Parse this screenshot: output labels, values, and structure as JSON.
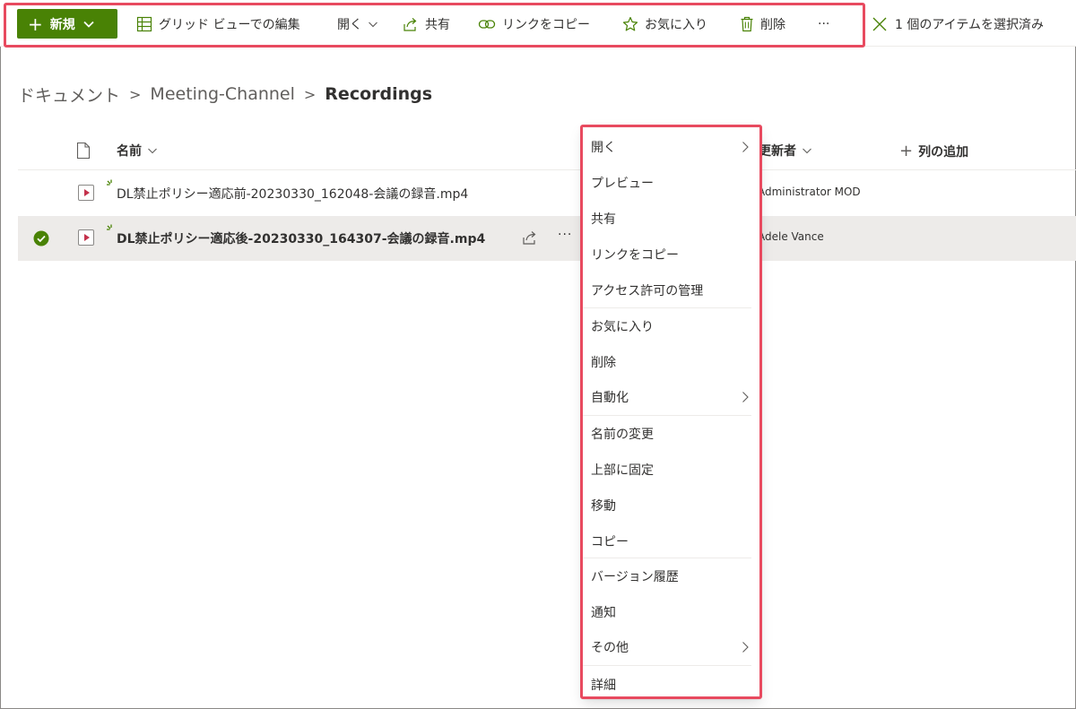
{
  "commandbar": {
    "new_label": "新規",
    "grid_edit_label": "グリッド ビューでの編集",
    "open_label": "開く",
    "share_label": "共有",
    "copy_link_label": "リンクをコピー",
    "favorite_label": "お気に入り",
    "delete_label": "削除",
    "more_label": "···",
    "selection_label": "1 個のアイテムを選択済み"
  },
  "breadcrumb": {
    "items": [
      "ドキュメント",
      "Meeting-Channel"
    ],
    "current": "Recordings",
    "separator": ">"
  },
  "list": {
    "columns": {
      "name": "名前",
      "modified_by": "更新者",
      "add_column": "列の追加"
    },
    "rows": [
      {
        "name": "DL禁止ポリシー適応前-20230330_162048-会議の録音.mp4",
        "modified_by": "Administrator MOD",
        "selected": false
      },
      {
        "name": "DL禁止ポリシー適応後-20230330_164307-会議の録音.mp4",
        "modified_by": "Adele Vance",
        "selected": true
      }
    ],
    "row_more_label": "···"
  },
  "context_menu": {
    "items": [
      {
        "label": "開く",
        "submenu": true
      },
      {
        "label": "プレビュー",
        "submenu": false
      },
      {
        "label": "共有",
        "submenu": false
      },
      {
        "label": "リンクをコピー",
        "submenu": false
      },
      {
        "label": "アクセス許可の管理",
        "submenu": false
      },
      {
        "label": "お気に入り",
        "submenu": false
      },
      {
        "label": "削除",
        "submenu": false
      },
      {
        "label": "自動化",
        "submenu": true
      },
      {
        "label": "名前の変更",
        "submenu": false
      },
      {
        "label": "上部に固定",
        "submenu": false
      },
      {
        "label": "移動",
        "submenu": false
      },
      {
        "label": "コピー",
        "submenu": false
      },
      {
        "label": "バージョン履歴",
        "submenu": false
      },
      {
        "label": "通知",
        "submenu": false
      },
      {
        "label": "その他",
        "submenu": true
      },
      {
        "label": "詳細",
        "submenu": false
      }
    ]
  },
  "colors": {
    "accent_green": "#498205",
    "highlight_red": "#e84a5f",
    "selected_row": "#edebe9"
  }
}
